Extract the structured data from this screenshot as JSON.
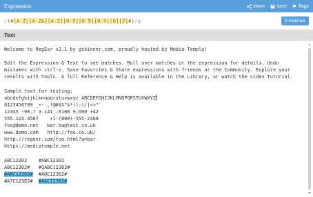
{
  "expression_panel": {
    "title": "Expression",
    "actions": [
      {
        "icon": "share-icon",
        "label": "share"
      },
      {
        "icon": "save-icon",
        "label": "save"
      },
      {
        "icon": "flag-icon",
        "label": "flags"
      }
    ],
    "regex": {
      "open_delim": "/",
      "tokens": [
        "(",
        "#",
        "[A-Z]",
        "[A-Z&]",
        "[A-Z]",
        "[0-9]",
        "[0-9]",
        "[0-9]",
        "[0]",
        "[2]",
        "#",
        ")"
      ],
      "close_delim": "/",
      "flags": "g"
    },
    "match_count": "2 matches"
  },
  "text_panel": {
    "title": "Text",
    "paragraphs": {
      "welcome": "Welcome to RegExr v2.1 by gskinner.com, proudly hosted by Media Temple!",
      "instructions": "Edit the Expression & Text to see matches. Roll over matches or the expression for details. Undo mistakes with ctrl-z. Save Favorites & Share expressions with friends or the Community. Explore your results with Tools. A full Reference & Help is available in the Library, or watch the video Tutorial."
    },
    "sample_lines": [
      "Sample text for testing:",
      "abcdefghijklmnopqrstuvwxyz ABCDEFGHIJKLMNOPQRSTUVWXYZ",
      "0123456789 _+-.,!@#$%^&*();\\/|<>\"'",
      "12345 -98.7 3.141 .6180 9,000 +42",
      "555.123.4567    +1-(800)-555-2468",
      "foo@demo.net   bar.ba@test.co.uk",
      "www.demo.com   http://foo.co.uk/",
      "http://regexr.com/foo.html?q=bar",
      "https://mediatemple.net"
    ],
    "code_rows": [
      {
        "left": "ABC12302",
        "gap": "    ",
        "right": "#ABC12302"
      },
      {
        "left": "ABC12302#",
        "gap": "   ",
        "right": "#QABC12302#"
      },
      {
        "left": "#ABC12302#",
        "gap": "  ",
        "right": "#A@C12302#"
      },
      {
        "left": "#A7C12302#",
        "gap": "  ",
        "right": "#A&C12302#"
      }
    ]
  }
}
